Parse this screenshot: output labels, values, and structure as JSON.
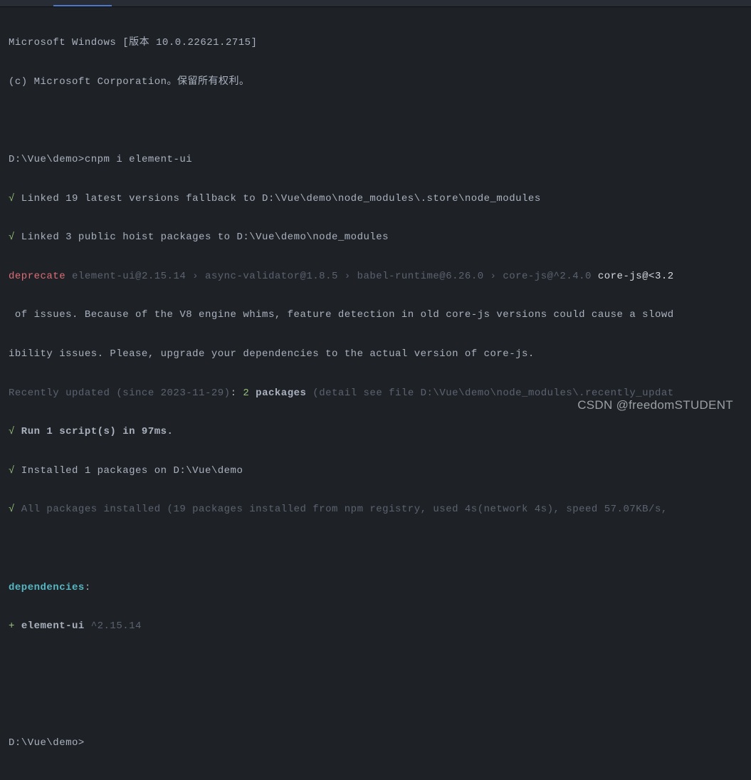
{
  "header": {
    "line1": "Microsoft Windows [版本 10.0.22621.2715]",
    "line2": "(c) Microsoft Corporation。保留所有权利。"
  },
  "prompt1": {
    "path": "D:\\Vue\\demo>",
    "command": "cnpm i element-ui"
  },
  "linked1": {
    "check": "√",
    "text": " Linked 19 latest versions fallback to D:\\Vue\\demo\\node_modules\\.store\\node_modules"
  },
  "linked2": {
    "check": "√",
    "text": " Linked 3 public hoist packages to D:\\Vue\\demo\\node_modules"
  },
  "deprecate": {
    "label": "deprecate",
    "chain": " element-ui@2.15.14 › async-validator@1.8.5 › babel-runtime@6.26.0 › core-js@^2.4.0 ",
    "tail": "core-js@<3.2",
    "line2": " of issues. Because of the V8 engine whims, feature detection in old core-js versions could cause a slowd",
    "line3": "ibility issues. Please, upgrade your dependencies to the actual version of core-js."
  },
  "recent": {
    "prefix": "Recently updated (since 2023-11-29)",
    "colon": ": ",
    "count": "2",
    "packages": " packages",
    "detail": " (detail see file D:\\Vue\\demo\\node_modules\\.recently_updat"
  },
  "run": {
    "check": "√",
    "text": " Run 1 script(s) in 97ms."
  },
  "installed": {
    "check": "√",
    "text": " Installed 1 packages on D:\\Vue\\demo"
  },
  "allpkg": {
    "check": "√",
    "text": " All packages installed (19 packages installed from npm registry, used 4s(network 4s), speed 57.07KB/s, "
  },
  "deps": {
    "label": "dependencies",
    "colon": ":"
  },
  "dep1": {
    "plus": "+ ",
    "name": "element-ui",
    "version": " ^2.15.14"
  },
  "prompt2": {
    "path": "D:\\Vue\\demo>"
  },
  "watermark": "CSDN @freedomSTUDENT"
}
